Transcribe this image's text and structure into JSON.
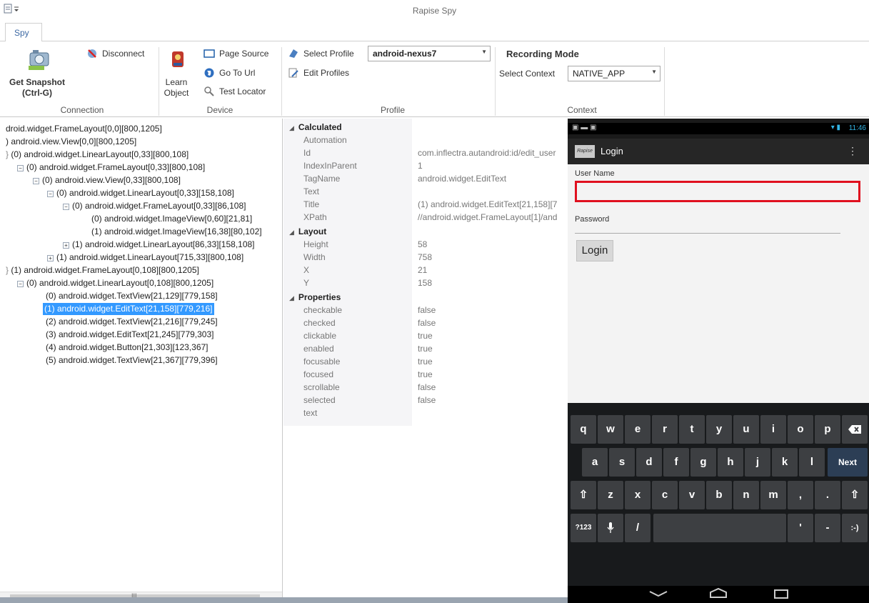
{
  "window": {
    "title": "Rapise Spy"
  },
  "ribbon": {
    "tab": "Spy",
    "connection": {
      "get_snapshot_line1": "Get Snapshot",
      "get_snapshot_line2": "(Ctrl-G)",
      "disconnect": "Disconnect",
      "group_label": "Connection"
    },
    "device": {
      "learn_line1": "Learn",
      "learn_line2": "Object",
      "page_source": "Page Source",
      "go_to_url": "Go To Url",
      "test_locator": "Test Locator",
      "group_label": "Device"
    },
    "profile": {
      "select_profile": "Select Profile",
      "profile_value": "android-nexus7",
      "edit_profiles": "Edit Profiles",
      "group_label": "Profile"
    },
    "context": {
      "recording_mode": "Recording Mode",
      "select_context": "Select Context",
      "context_value": "NATIVE_APP",
      "group_label": "Context"
    }
  },
  "tree": {
    "items": [
      "droid.widget.FrameLayout[0,0][800,1205]",
      ") android.view.View[0,0][800,1205]",
      "(0) android.widget.LinearLayout[0,33][800,108]",
      "(0) android.widget.FrameLayout[0,33][800,108]",
      "(0) android.view.View[0,33][800,108]",
      "(0) android.widget.LinearLayout[0,33][158,108]",
      "(0) android.widget.FrameLayout[0,33][86,108]",
      "(0) android.widget.ImageView[0,60][21,81]",
      "(1) android.widget.ImageView[16,38][80,102]",
      "(1) android.widget.LinearLayout[86,33][158,108]",
      "(1) android.widget.LinearLayout[715,33][800,108]",
      "(1) android.widget.FrameLayout[0,108][800,1205]",
      "(0) android.widget.LinearLayout[0,108][800,1205]",
      "(0) android.widget.TextView[21,129][779,158]",
      "(1) android.widget.EditText[21,158][779,216]",
      "(2) android.widget.TextView[21,216][779,245]",
      "(3) android.widget.EditText[21,245][779,303]",
      "(4) android.widget.Button[21,303][123,367]",
      "(5) android.widget.TextView[21,367][779,396]"
    ],
    "scroll_marker": "III"
  },
  "properties": {
    "calculated": {
      "header": "Calculated",
      "rows": [
        {
          "name": "Automation",
          "value": ""
        },
        {
          "name": "Id",
          "value": "com.inflectra.autandroid:id/edit_user"
        },
        {
          "name": "IndexInParent",
          "value": "1"
        },
        {
          "name": "TagName",
          "value": "android.widget.EditText"
        },
        {
          "name": "Text",
          "value": ""
        },
        {
          "name": "Title",
          "value": "(1) android.widget.EditText[21,158][7"
        },
        {
          "name": "XPath",
          "value": "//android.widget.FrameLayout[1]/and"
        }
      ]
    },
    "layout": {
      "header": "Layout",
      "rows": [
        {
          "name": "Height",
          "value": "58"
        },
        {
          "name": "Width",
          "value": "758"
        },
        {
          "name": "X",
          "value": "21"
        },
        {
          "name": "Y",
          "value": "158"
        }
      ]
    },
    "props": {
      "header": "Properties",
      "rows": [
        {
          "name": "checkable",
          "value": "false"
        },
        {
          "name": "checked",
          "value": "false"
        },
        {
          "name": "clickable",
          "value": "true"
        },
        {
          "name": "enabled",
          "value": "true"
        },
        {
          "name": "focusable",
          "value": "true"
        },
        {
          "name": "focused",
          "value": "true"
        },
        {
          "name": "scrollable",
          "value": "false"
        },
        {
          "name": "selected",
          "value": "false"
        },
        {
          "name": "text",
          "value": ""
        }
      ]
    }
  },
  "phone": {
    "status_time": "11:46",
    "app_icon_text": "Rapise",
    "app_title": "Login",
    "user_name_label": "User Name",
    "password_label": "Password",
    "login_button": "Login",
    "keyboard": {
      "row1": [
        "q",
        "w",
        "e",
        "r",
        "t",
        "y",
        "u",
        "i",
        "o",
        "p"
      ],
      "row2": [
        "a",
        "s",
        "d",
        "f",
        "g",
        "h",
        "j",
        "k",
        "l"
      ],
      "row3": [
        "z",
        "x",
        "c",
        "v",
        "b",
        "n",
        "m",
        ",",
        "."
      ],
      "next_key": "Next",
      "sym_key": "?123",
      "slash_key": "/",
      "quote_key": "'",
      "dash_key": "-",
      "smiley_key": ":-)"
    }
  },
  "colors": {
    "selection": "#3399ff",
    "highlight_border": "#e0101f",
    "ribbon_tab_text": "#3e6aa4"
  }
}
